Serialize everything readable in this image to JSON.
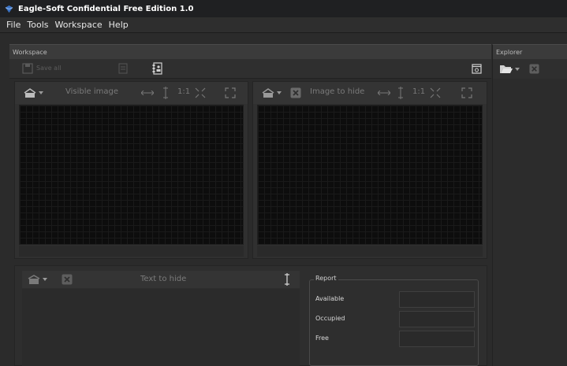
{
  "window": {
    "title": "Eagle-Soft Confidential Free Edition 1.0"
  },
  "menu": {
    "items": [
      "File",
      "Tools",
      "Workspace",
      "Help"
    ]
  },
  "workspace": {
    "header": "Workspace",
    "save_label": "Save all"
  },
  "visible_panel": {
    "label": "Visible image",
    "fit_label": "1:1"
  },
  "hide_panel": {
    "label": "Image to hide",
    "fit_label": "1:1"
  },
  "text_panel": {
    "label": "Text to hide"
  },
  "report": {
    "title": "Report",
    "rows": [
      "Available",
      "Occupied",
      "Free"
    ]
  },
  "explorer": {
    "header": "Explorer"
  },
  "colors": {
    "background": "#2b2b2b",
    "titlebar": "#1f2022",
    "canvas": "#0d0d0d",
    "accent": "#3a74c8"
  }
}
